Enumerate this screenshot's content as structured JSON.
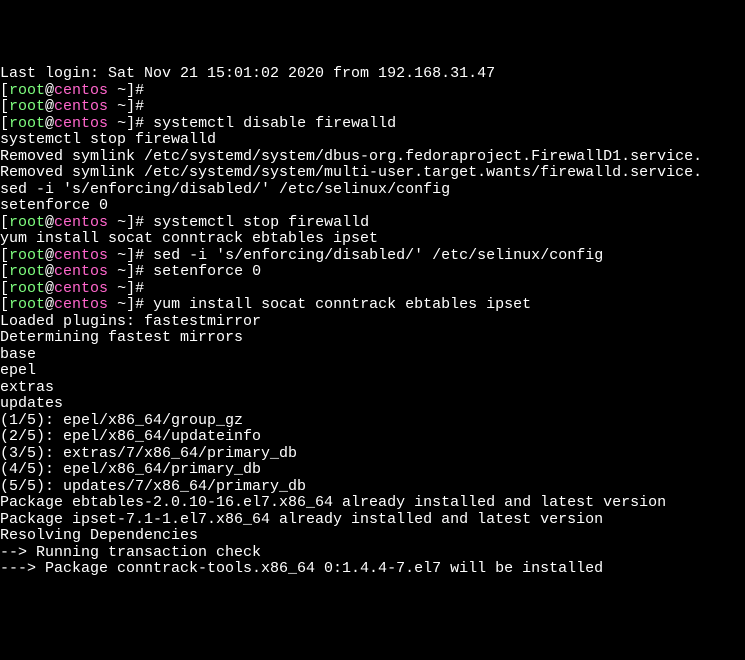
{
  "lines": [
    {
      "type": "plain",
      "text": "Last login: Sat Nov 21 15:01:02 2020 from 192.168.31.47"
    },
    {
      "type": "prompt",
      "user": "root",
      "host": "centos",
      "path": "~",
      "cmd": ""
    },
    {
      "type": "prompt",
      "user": "root",
      "host": "centos",
      "path": "~",
      "cmd": ""
    },
    {
      "type": "prompt",
      "user": "root",
      "host": "centos",
      "path": "~",
      "cmd": "systemctl disable firewalld"
    },
    {
      "type": "plain",
      "text": "systemctl stop firewalld"
    },
    {
      "type": "plain",
      "text": "Removed symlink /etc/systemd/system/dbus-org.fedoraproject.FirewallD1.service."
    },
    {
      "type": "plain",
      "text": "Removed symlink /etc/systemd/system/multi-user.target.wants/firewalld.service."
    },
    {
      "type": "plain",
      "text": "sed -i 's/enforcing/disabled/' /etc/selinux/config"
    },
    {
      "type": "plain",
      "text": "setenforce 0"
    },
    {
      "type": "plain",
      "text": ""
    },
    {
      "type": "prompt",
      "user": "root",
      "host": "centos",
      "path": "~",
      "cmd": "systemctl stop firewalld"
    },
    {
      "type": "plain",
      "text": "yum install socat conntrack ebtables ipset"
    },
    {
      "type": "plain",
      "text": ""
    },
    {
      "type": "prompt",
      "user": "root",
      "host": "centos",
      "path": "~",
      "cmd": "sed -i 's/enforcing/disabled/' /etc/selinux/config"
    },
    {
      "type": "prompt",
      "user": "root",
      "host": "centos",
      "path": "~",
      "cmd": "setenforce 0"
    },
    {
      "type": "prompt",
      "user": "root",
      "host": "centos",
      "path": "~",
      "cmd": ""
    },
    {
      "type": "prompt",
      "user": "root",
      "host": "centos",
      "path": "~",
      "cmd": "yum install socat conntrack ebtables ipset"
    },
    {
      "type": "plain",
      "text": "Loaded plugins: fastestmirror"
    },
    {
      "type": "plain",
      "text": "Determining fastest mirrors"
    },
    {
      "type": "plain",
      "text": "base"
    },
    {
      "type": "plain",
      "text": "epel"
    },
    {
      "type": "plain",
      "text": "extras"
    },
    {
      "type": "plain",
      "text": "updates"
    },
    {
      "type": "plain",
      "text": "(1/5): epel/x86_64/group_gz"
    },
    {
      "type": "plain",
      "text": "(2/5): epel/x86_64/updateinfo"
    },
    {
      "type": "plain",
      "text": "(3/5): extras/7/x86_64/primary_db"
    },
    {
      "type": "plain",
      "text": "(4/5): epel/x86_64/primary_db"
    },
    {
      "type": "plain",
      "text": "(5/5): updates/7/x86_64/primary_db"
    },
    {
      "type": "plain",
      "text": "Package ebtables-2.0.10-16.el7.x86_64 already installed and latest version"
    },
    {
      "type": "plain",
      "text": "Package ipset-7.1-1.el7.x86_64 already installed and latest version"
    },
    {
      "type": "plain",
      "text": "Resolving Dependencies"
    },
    {
      "type": "plain",
      "text": "--> Running transaction check"
    },
    {
      "type": "plain",
      "text": "---> Package conntrack-tools.x86_64 0:1.4.4-7.el7 will be installed"
    }
  ]
}
